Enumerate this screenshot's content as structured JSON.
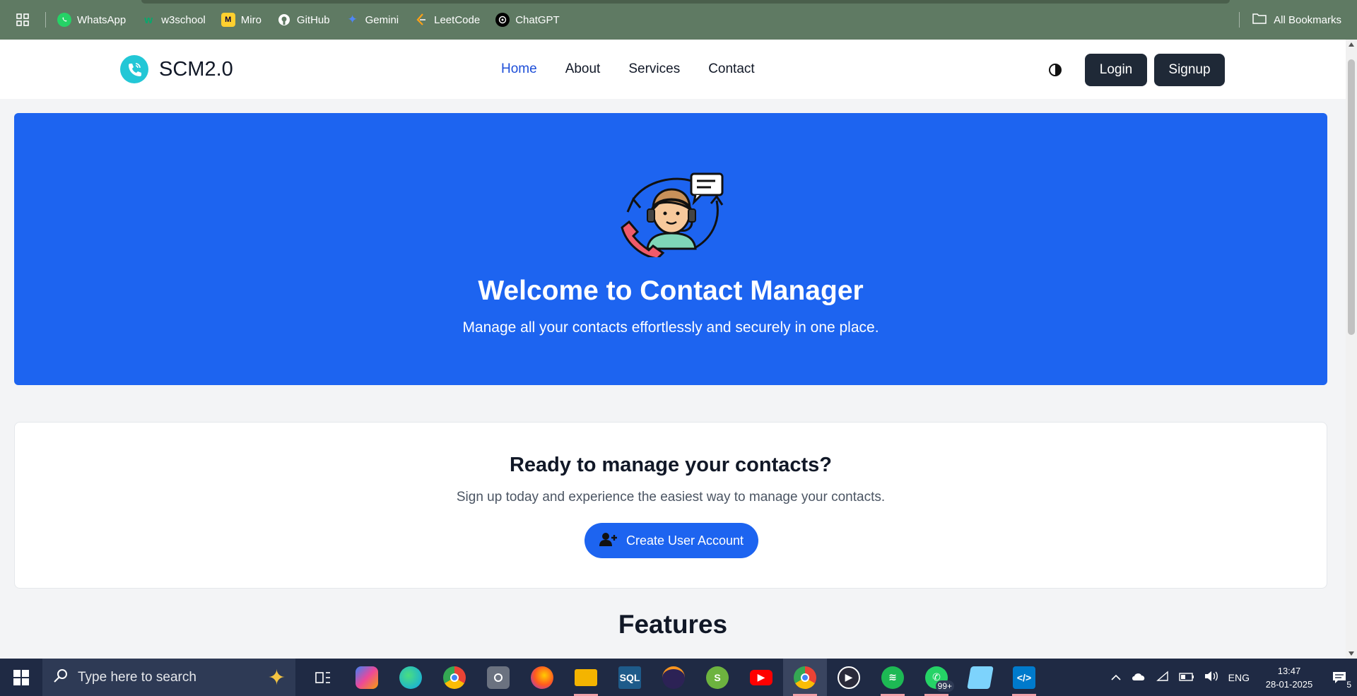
{
  "bookmarks": {
    "items": [
      {
        "label": "WhatsApp",
        "icon": "whatsapp-icon",
        "color": "#25d366"
      },
      {
        "label": "w3school",
        "icon": "w3schools-icon",
        "color": "#04aa6d"
      },
      {
        "label": "Miro",
        "icon": "miro-icon",
        "color": "#ffd02f"
      },
      {
        "label": "GitHub",
        "icon": "github-icon",
        "color": "#ffffff"
      },
      {
        "label": "Gemini",
        "icon": "gemini-icon",
        "color": "#4f86f7"
      },
      {
        "label": "LeetCode",
        "icon": "leetcode-icon",
        "color": "#ffa116"
      },
      {
        "label": "ChatGPT",
        "icon": "chatgpt-icon",
        "color": "#000000"
      }
    ],
    "all_bookmarks": "All Bookmarks"
  },
  "navbar": {
    "brand": "SCM2.0",
    "links": [
      "Home",
      "About",
      "Services",
      "Contact"
    ],
    "active_link": "Home",
    "login": "Login",
    "signup": "Signup"
  },
  "hero": {
    "title": "Welcome to Contact Manager",
    "subtitle": "Manage all your contacts effortlessly and securely in one place."
  },
  "cta": {
    "title": "Ready to manage your contacts?",
    "subtitle": "Sign up today and experience the easiest way to manage your contacts.",
    "button": "Create User Account"
  },
  "features": {
    "title": "Features"
  },
  "taskbar": {
    "search_placeholder": "Type here to search",
    "whatsapp_badge": "99+",
    "tray": {
      "language": "ENG",
      "time": "13:47",
      "date": "28-01-2025",
      "notifications": "5"
    }
  },
  "colors": {
    "hero_bg": "#1d64f0",
    "primary": "#1d64f0",
    "dark_button": "#1f2937",
    "bookmarks_bar": "#5f7a63",
    "brand_logo": "#22c7d6"
  }
}
